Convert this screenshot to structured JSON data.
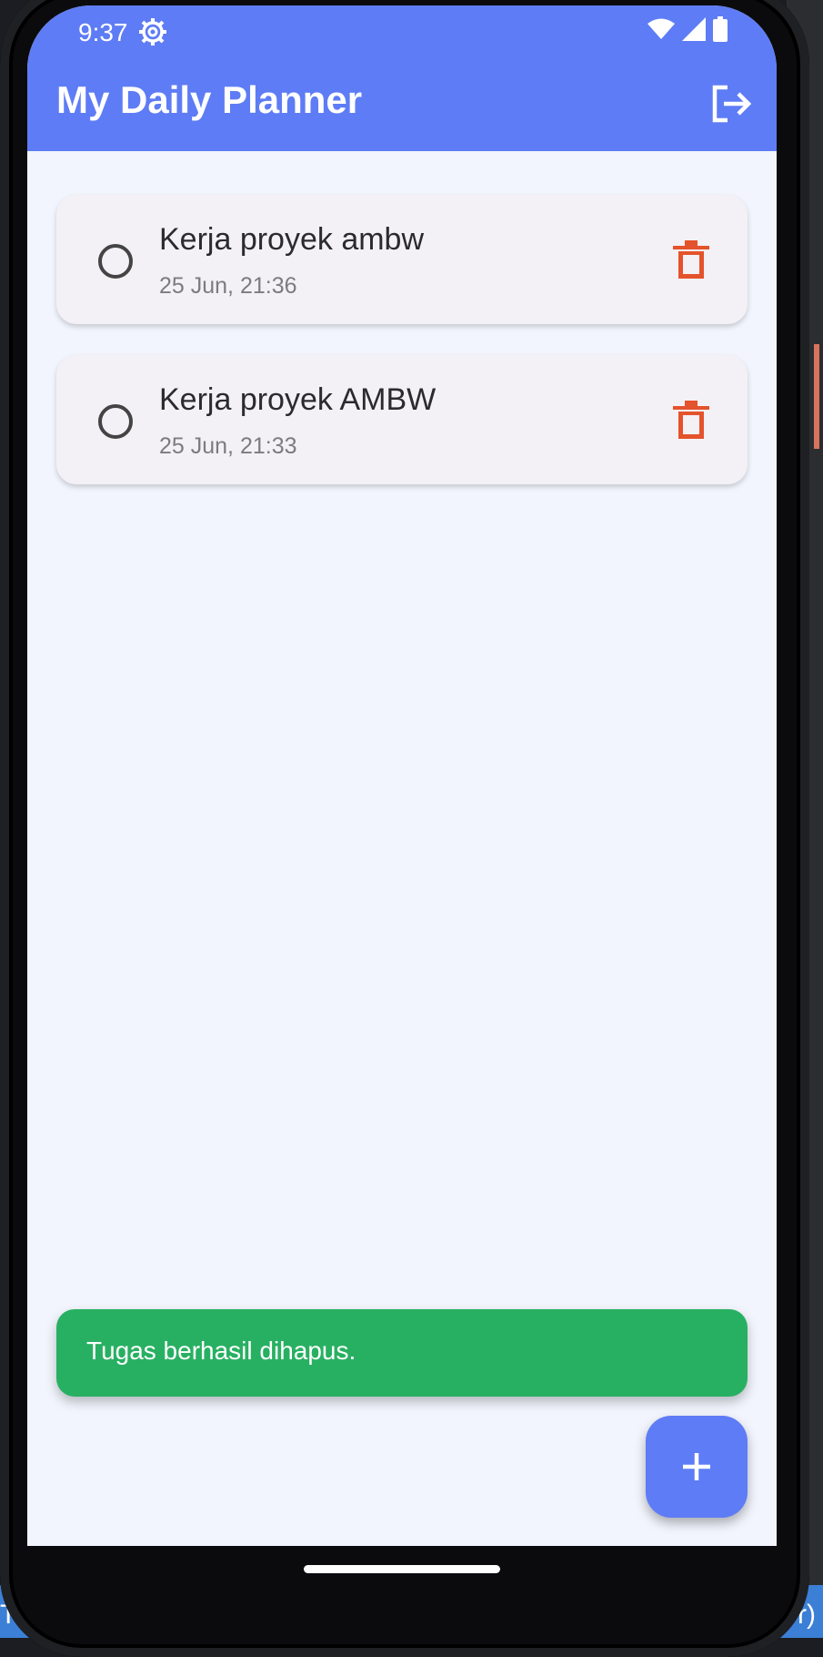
{
  "status_bar": {
    "time": "9:37",
    "icons": [
      "settings-gear-icon",
      "wifi-icon",
      "cellular-signal-icon",
      "battery-icon"
    ]
  },
  "app_bar": {
    "title": "My Daily Planner",
    "action_icon": "logout-icon"
  },
  "tasks": [
    {
      "title": "Kerja proyek ambw",
      "time": "25 Jun, 21:36",
      "completed": false
    },
    {
      "title": "Kerja proyek AMBW",
      "time": "25 Jun, 21:33",
      "completed": false
    }
  ],
  "snackbar": {
    "message": "Tugas berhasil dihapus."
  },
  "fab": {
    "icon": "plus-icon"
  },
  "background_text": {
    "left": "TF",
    "right": "or)"
  },
  "colors": {
    "primary": "#5e7cf5",
    "background": "#f2f5fd",
    "card": "#f3f1f6",
    "delete": "#e4532c",
    "snackbar": "#28b062"
  }
}
